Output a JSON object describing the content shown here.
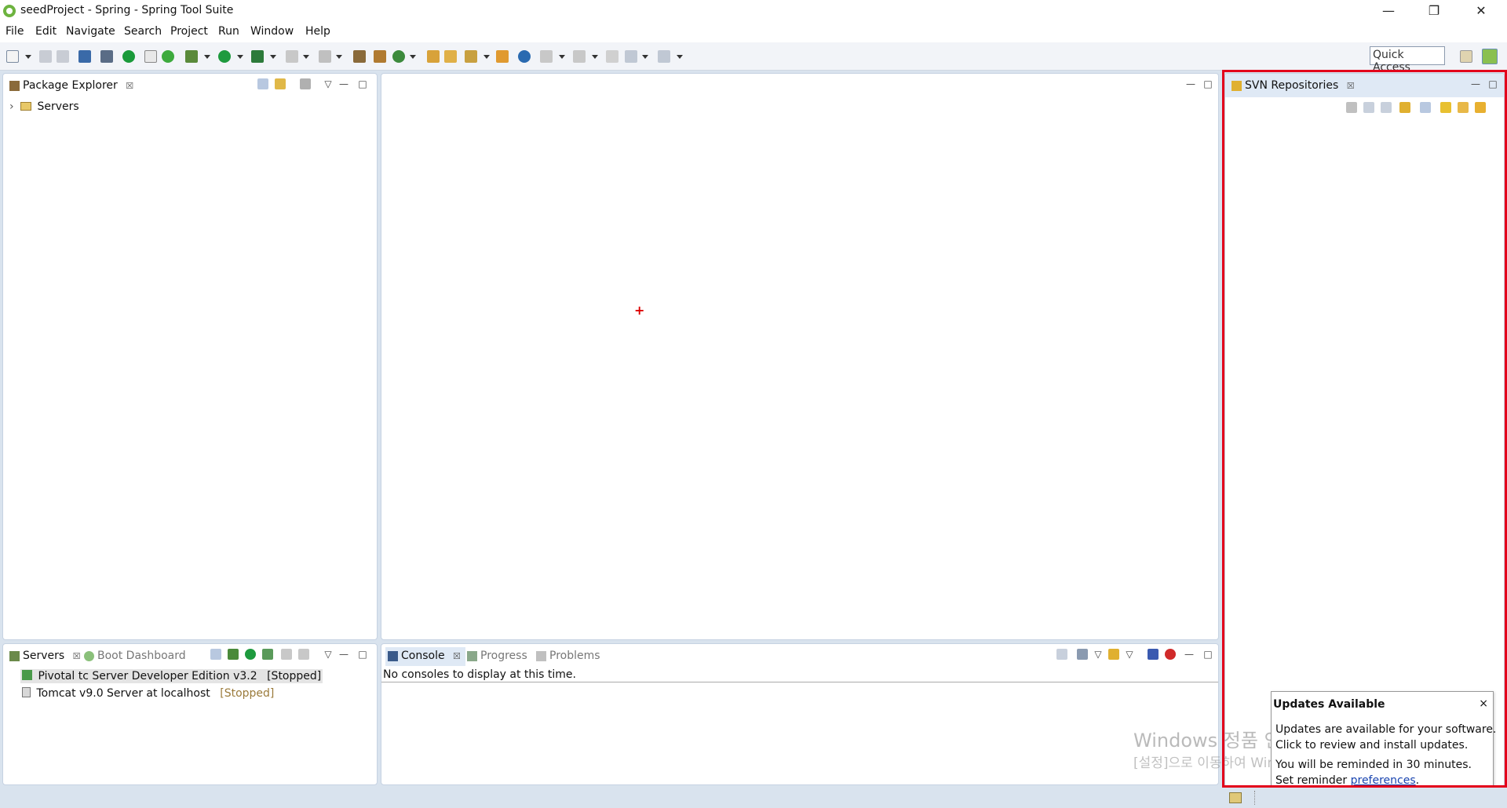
{
  "window": {
    "title": "seedProject - Spring - Spring Tool Suite",
    "controls": {
      "minimize": "—",
      "restore": "❐",
      "close": "✕"
    }
  },
  "menu": {
    "items": [
      "File",
      "Edit",
      "Navigate",
      "Search",
      "Project",
      "Run",
      "Window",
      "Help"
    ]
  },
  "toolbar": {
    "quick_access": "Quick Access"
  },
  "package_explorer": {
    "tab_label": "Package Explorer",
    "close": "☒",
    "tree": [
      {
        "label": "Servers",
        "expander": "›"
      }
    ]
  },
  "editor": {
    "cross": "+"
  },
  "svn": {
    "tab_label": "SVN Repositories",
    "close": "☒"
  },
  "servers_panel": {
    "tabs": [
      {
        "label": "Servers",
        "close": "☒"
      },
      {
        "label": "Boot Dashboard"
      }
    ],
    "servers": [
      {
        "name": "Pivotal tc Server Developer Edition v3.2",
        "status": "[Stopped]"
      },
      {
        "name": "Tomcat v9.0 Server at localhost",
        "status": "[Stopped]"
      }
    ]
  },
  "console_panel": {
    "tabs": [
      {
        "label": "Console",
        "close": "☒"
      },
      {
        "label": "Progress"
      },
      {
        "label": "Problems"
      }
    ],
    "message": "No consoles to display at this time."
  },
  "updates_popup": {
    "title": "Updates Available",
    "close": "×",
    "line1": "Updates are available for your software.",
    "line2": "Click to review and install updates.",
    "line3": "You will be reminded in 30 minutes.",
    "line4_prefix": "Set reminder ",
    "link": "preferences",
    "line4_suffix": "."
  },
  "watermark": {
    "line1": "Windows 정품 인증",
    "line2": "[설정]으로 이동하여 Windows를 정품 인증합니다."
  },
  "panel_controls": {
    "minimize": "—",
    "maximize": "□",
    "menu": "▽"
  }
}
